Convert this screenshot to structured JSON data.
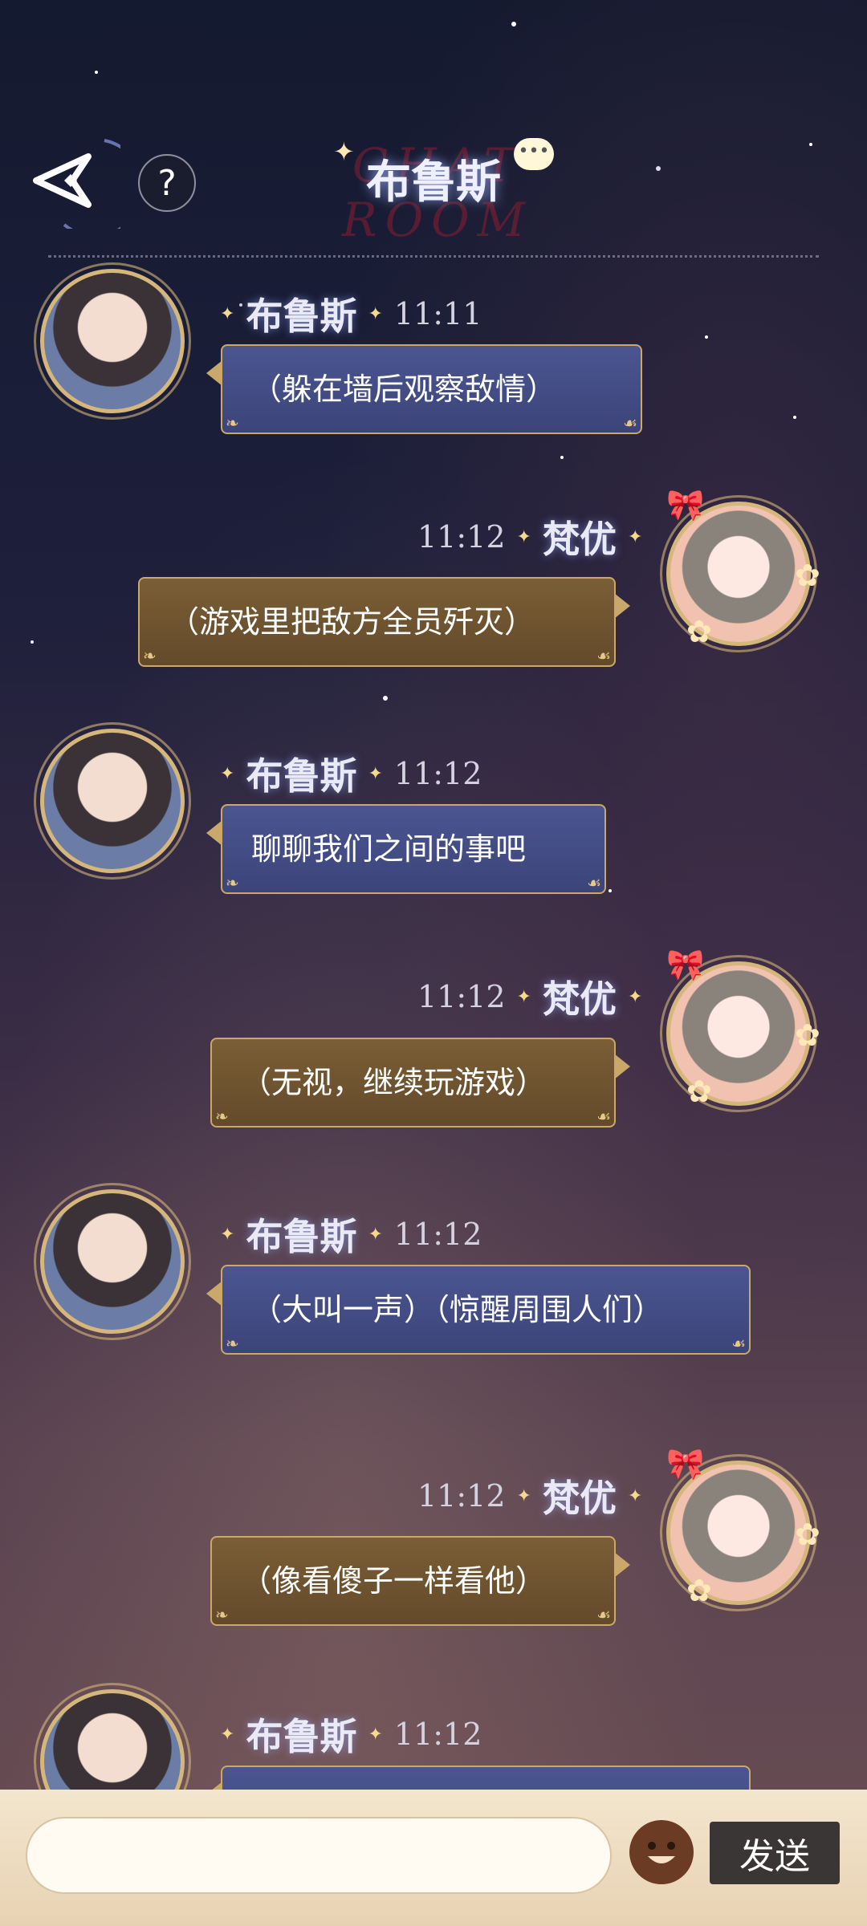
{
  "header": {
    "back_label": "",
    "help_label": "?",
    "title_bg": "CHAT ROOM",
    "title": "布鲁斯"
  },
  "messages": [
    {
      "sender": "布鲁斯",
      "time": "11:11",
      "text": "（躲在墙后观察敌情）",
      "side": "left"
    },
    {
      "sender": "梵优",
      "time": "11:12",
      "text": "（游戏里把敌方全员歼灭）",
      "side": "right"
    },
    {
      "sender": "布鲁斯",
      "time": "11:12",
      "text": "聊聊我们之间的事吧",
      "side": "left"
    },
    {
      "sender": "梵优",
      "time": "11:12",
      "text": "（无视，继续玩游戏）",
      "side": "right"
    },
    {
      "sender": "布鲁斯",
      "time": "11:12",
      "text": "（大叫一声）（惊醒周围人们）",
      "side": "left"
    },
    {
      "sender": "梵优",
      "time": "11:12",
      "text": "（像看傻子一样看他）",
      "side": "right"
    },
    {
      "sender": "布鲁斯",
      "time": "11:12",
      "text": "",
      "side": "left"
    }
  ],
  "input": {
    "placeholder": "",
    "send_label": "发送"
  },
  "colors": {
    "bubble_blue": "#4b5590",
    "bubble_gold": "#7a5e36",
    "accent_gold": "#c9a869"
  }
}
